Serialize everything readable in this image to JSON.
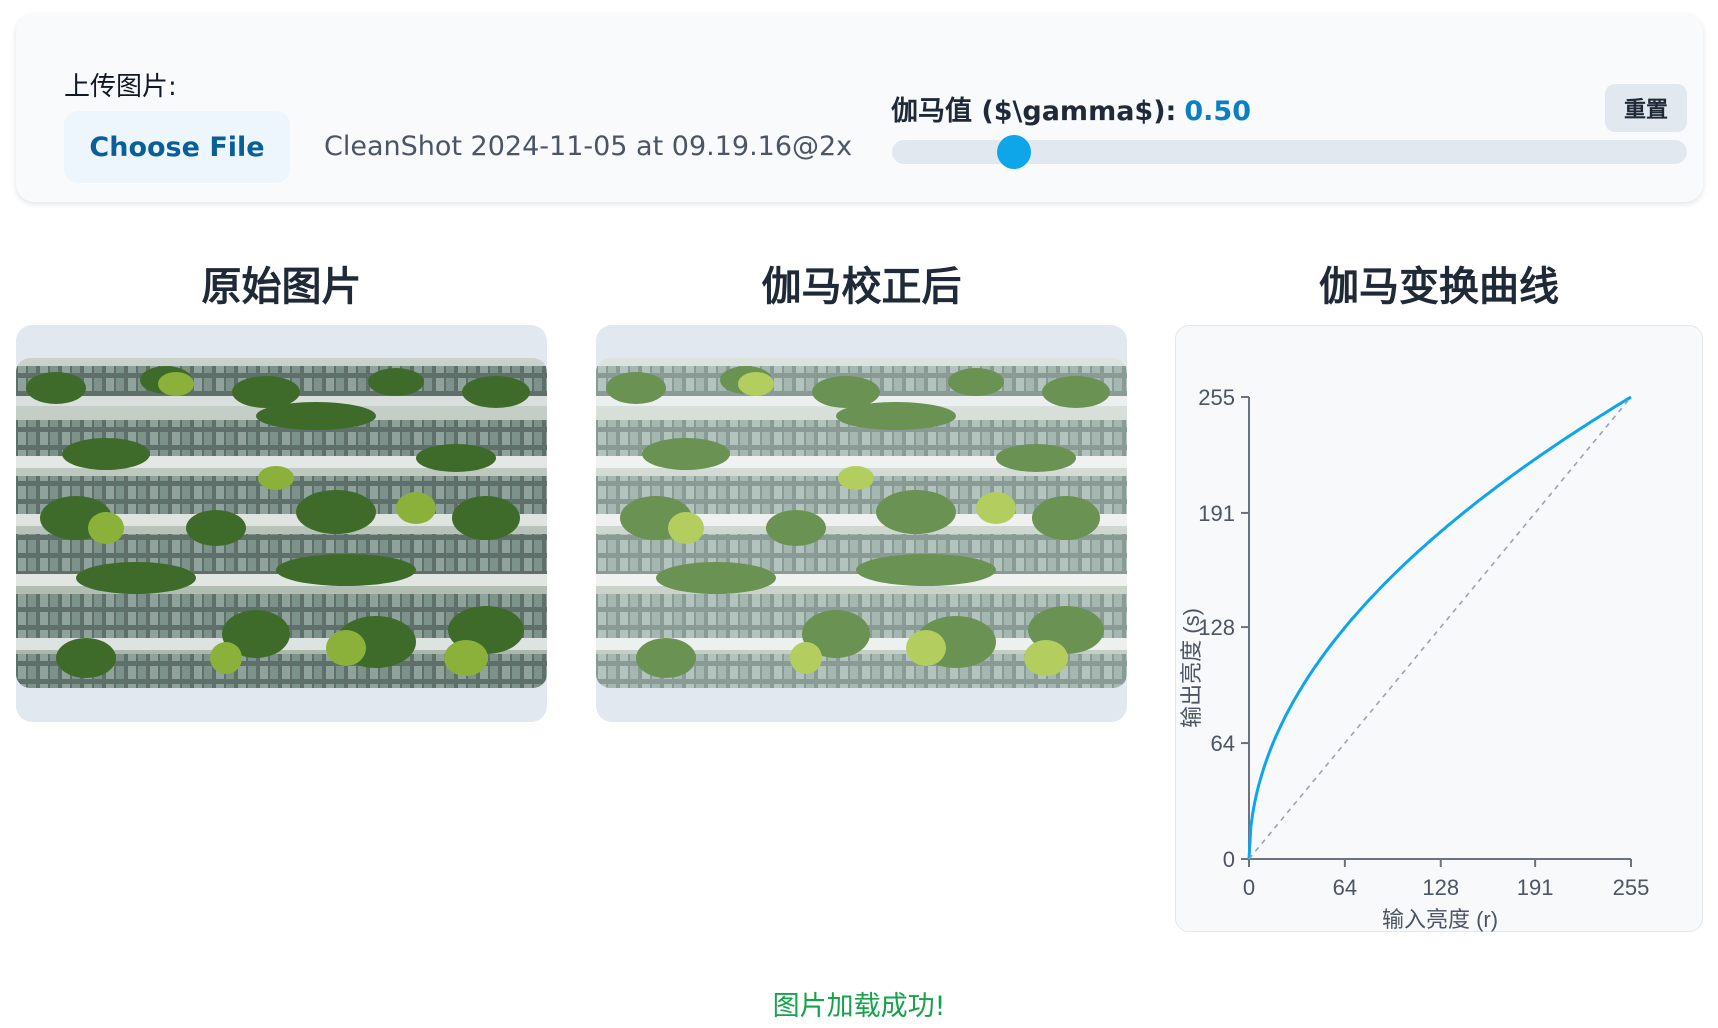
{
  "upload": {
    "label": "上传图片:",
    "button_label": "Choose File",
    "file_name": "CleanShot 2024-11-05 at 09.19.16@2x"
  },
  "gamma": {
    "label": "伽马值 ($\\gamma$):",
    "value_text": "0.50",
    "value": 0.5,
    "min": 0.1,
    "max": 3.0,
    "reset_label": "重置"
  },
  "columns": {
    "original_title": "原始图片",
    "corrected_title": "伽马校正后",
    "curve_title": "伽马变换曲线"
  },
  "images": {
    "original_alt": "原始图片",
    "corrected_alt": "伽马校正后"
  },
  "chart_data": {
    "type": "line",
    "title": "",
    "xlabel": "输入亮度 (r)",
    "ylabel": "输出亮度 (s)",
    "xlim": [
      0,
      255
    ],
    "ylim": [
      0,
      255
    ],
    "xticks": [
      0,
      64,
      128,
      191,
      255
    ],
    "yticks": [
      0,
      64,
      128,
      191,
      255
    ],
    "grid": false,
    "series": [
      {
        "gamma": 0.5,
        "color": "#0ea5e9",
        "style": "solid",
        "x": [
          0,
          1,
          4,
          16,
          32,
          48,
          64,
          96,
          128,
          160,
          191,
          224,
          255
        ],
        "y": [
          0,
          16,
          32,
          64,
          90,
          111,
          128,
          156,
          181,
          202,
          221,
          239,
          255
        ]
      },
      {
        "gamma": 1.0,
        "color": "#9ca3af",
        "style": "dashed",
        "x": [
          0,
          255
        ],
        "y": [
          0,
          255
        ]
      }
    ]
  },
  "status": {
    "message": "图片加载成功!",
    "color": "#16a34a"
  }
}
